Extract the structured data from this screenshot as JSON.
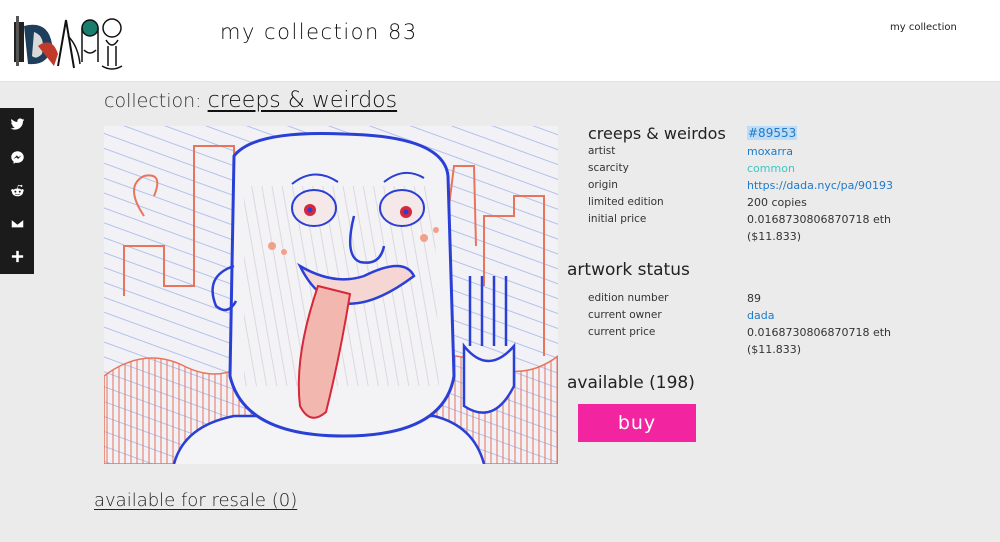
{
  "header": {
    "site_title": "my collection 83",
    "nav_my_collection": "my collection"
  },
  "share": {
    "icons": [
      "twitter-icon",
      "messenger-icon",
      "reddit-icon",
      "mail-icon",
      "plus-icon"
    ],
    "bar_color": "#1b1b1b"
  },
  "collection": {
    "prefix": "collection:",
    "name": "creeps & weirdos"
  },
  "artwork": {
    "title": "creeps & weirdos",
    "id": "#89553",
    "details": [
      {
        "label": "artist",
        "value": "moxarra",
        "style": "link"
      },
      {
        "label": "scarcity",
        "value": "common",
        "style": "common"
      },
      {
        "label": "origin",
        "value": "https://dada.nyc/pa/90193",
        "style": "link"
      },
      {
        "label": "limited edition",
        "value": "200 copies",
        "style": "plain"
      },
      {
        "label": "initial price",
        "value": "0.0168730806870718 eth",
        "value2": "($11.833)",
        "style": "plain"
      }
    ]
  },
  "status": {
    "title": "artwork status",
    "details": [
      {
        "label": "edition number",
        "value": "89",
        "style": "plain"
      },
      {
        "label": "current owner",
        "value": "dada",
        "style": "link"
      },
      {
        "label": "current price",
        "value": "0.0168730806870718 eth",
        "value2": "($11.833)",
        "style": "plain"
      }
    ]
  },
  "availability": {
    "label": "available (198)",
    "buy_label": "buy",
    "resale_label": "available for resale (0)"
  },
  "colors": {
    "accent_pink": "#f2249f",
    "link_blue": "#1f7ac8",
    "common_teal": "#3cc5c5",
    "background": "#ebebeb"
  }
}
